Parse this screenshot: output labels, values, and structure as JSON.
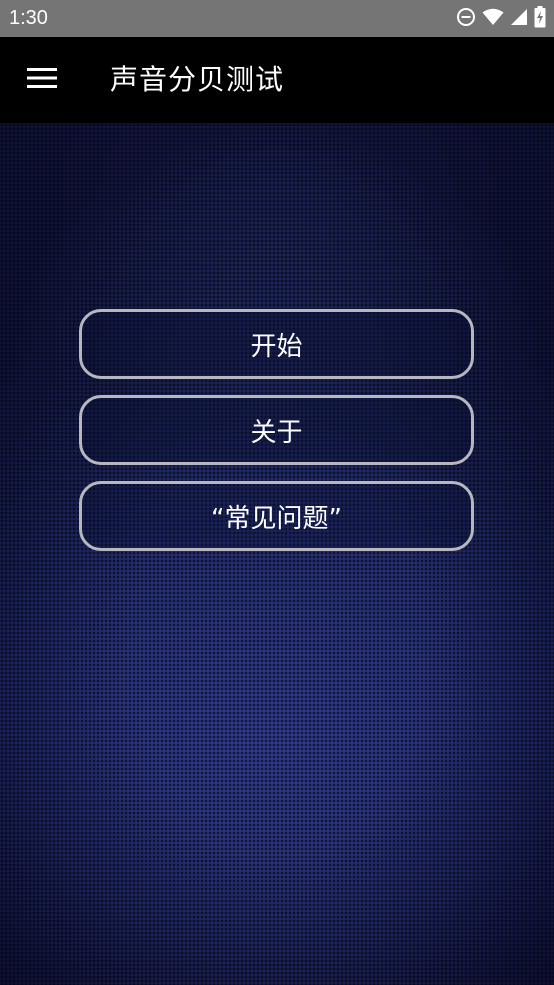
{
  "status_bar": {
    "time": "1:30",
    "icons": [
      "do-not-disturb-icon",
      "wifi-icon",
      "signal-icon",
      "battery-charging-icon"
    ]
  },
  "toolbar": {
    "menu_icon": "hamburger-menu-icon",
    "title": "声音分贝测试"
  },
  "main": {
    "buttons": [
      {
        "label": "开始"
      },
      {
        "label": "关于"
      },
      {
        "label": "“常见问题”"
      }
    ]
  },
  "colors": {
    "status_bar": "#757575",
    "toolbar": "#000000",
    "background": "#0b1248",
    "button_border": "#b7b7bf",
    "text": "#ffffff"
  }
}
